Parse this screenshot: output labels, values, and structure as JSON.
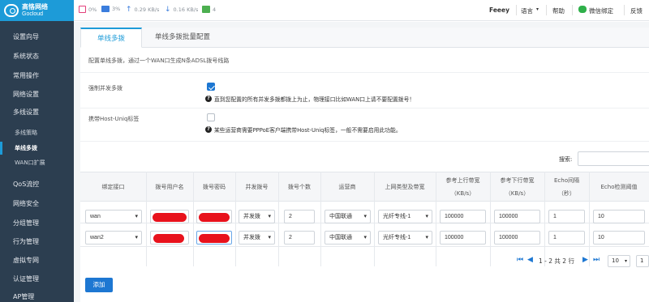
{
  "brand": {
    "name_cn": "高恪网络",
    "name_en": "Gocloud"
  },
  "sidebar": {
    "items": [
      {
        "label": "设置向导"
      },
      {
        "label": "系统状态"
      },
      {
        "label": "常用操作"
      },
      {
        "label": "网络设置"
      },
      {
        "label": "多线设置"
      }
    ],
    "subitems": [
      {
        "label": "多线策略"
      },
      {
        "label": "单线多拨"
      },
      {
        "label": "WAN口扩展"
      }
    ],
    "items2": [
      {
        "label": "QoS流控"
      },
      {
        "label": "网络安全"
      },
      {
        "label": "分组管理"
      },
      {
        "label": "行为管理"
      },
      {
        "label": "虚拟专网"
      },
      {
        "label": "认证管理"
      },
      {
        "label": "AP管理"
      }
    ]
  },
  "topbar": {
    "cpu": "0%",
    "mem": "3%",
    "up": "0.29 KB/s",
    "down": "0.16 KB/s",
    "users": "4",
    "user": "Feeey",
    "language": "语言",
    "help": "帮助",
    "wechat": "微信绑定",
    "feedback": "反馈"
  },
  "tabs": [
    "单线多拨",
    "单线多拨批量配置"
  ],
  "description": "配置单线多拨，通过一个WAN口生成N条ADSL拨号线路",
  "settings": {
    "force_label": "强制并发多拨",
    "force_hint": "直到您配置的所有并发多拨都拨上为止，物理接口比如WAN口上请不要配置拨号！",
    "hostuniq_label": "携带Host-Uniq标签",
    "hostuniq_hint": "某些运营商需要PPPoE客户端携带Host-Uniq标签，一般不需要启用此功能。"
  },
  "search": {
    "label": "搜索:"
  },
  "table": {
    "headers": [
      {
        "line1": "绑定接口"
      },
      {
        "line1": "拨号用户名"
      },
      {
        "line1": "拨号密码"
      },
      {
        "line1": "并发拨号"
      },
      {
        "line1": "拨号个数"
      },
      {
        "line1": "运营商"
      },
      {
        "line1": "上网类型及带宽"
      },
      {
        "line1": "参考上行带宽",
        "line2": "（KB/s）"
      },
      {
        "line1": "参考下行带宽",
        "line2": "（KB/s）"
      },
      {
        "line1": "Echo间隔",
        "line2": "（秒）"
      },
      {
        "line1": "Echo检测阈值"
      }
    ],
    "rows": [
      {
        "iface": "wan",
        "concurrent": "并发拨",
        "count": "2",
        "isp": "中国联通",
        "type": "光纤专线-1",
        "up": "100000",
        "down": "100000",
        "echo": "1",
        "threshold": "10"
      },
      {
        "iface": "wan2",
        "concurrent": "并发拨",
        "count": "2",
        "isp": "中国联通",
        "type": "光纤专线-1",
        "up": "100000",
        "down": "100000",
        "echo": "1",
        "threshold": "10"
      }
    ]
  },
  "pager": {
    "info": "1 - 2 共 2 行",
    "page_size": "10",
    "page": "1"
  },
  "add_button": "添加"
}
